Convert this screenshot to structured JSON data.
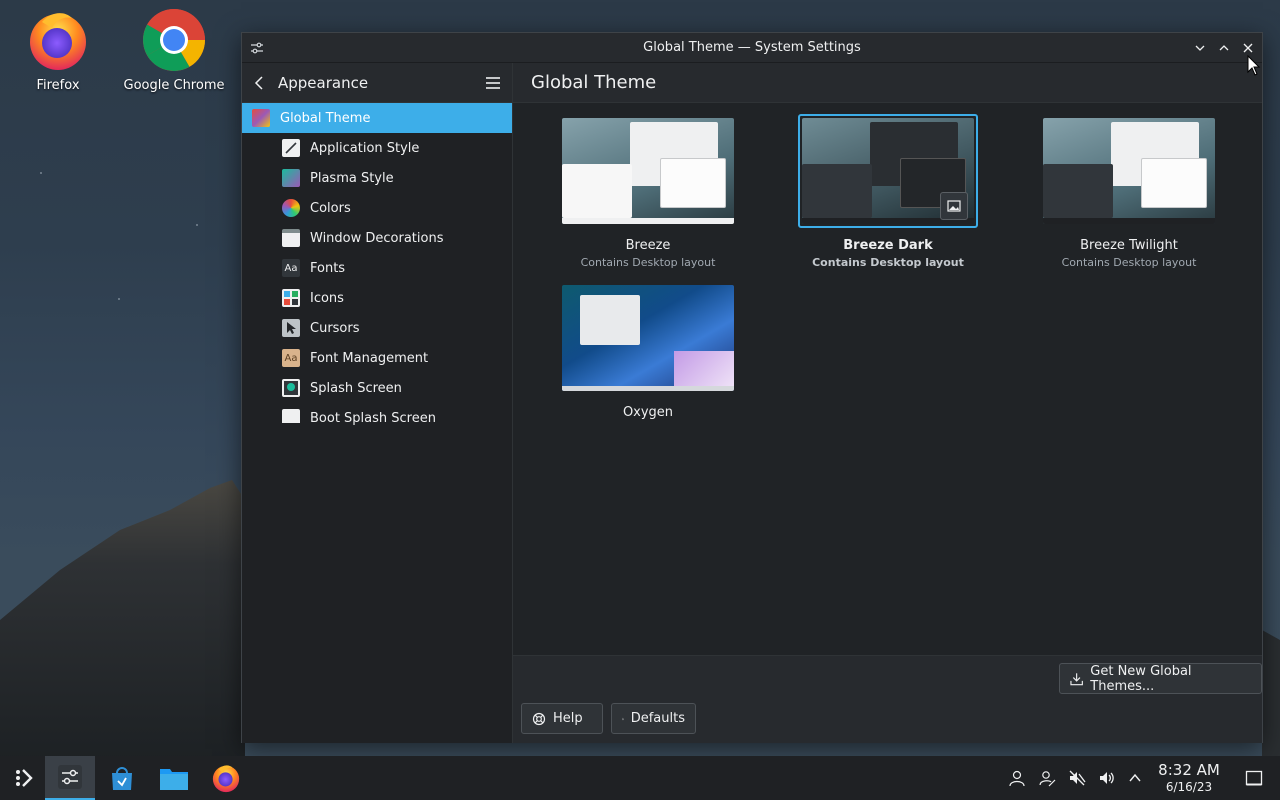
{
  "desktop": {
    "icons": [
      {
        "label": "Firefox"
      },
      {
        "label": "Google Chrome"
      }
    ]
  },
  "window": {
    "title": "Global Theme — System Settings"
  },
  "sidebar": {
    "header": "Appearance",
    "items": [
      {
        "label": "Global Theme",
        "icon": "global-theme-icon",
        "active": true
      },
      {
        "label": "Application Style",
        "icon": "application-style-icon"
      },
      {
        "label": "Plasma Style",
        "icon": "plasma-style-icon"
      },
      {
        "label": "Colors",
        "icon": "colors-icon"
      },
      {
        "label": "Window Decorations",
        "icon": "window-decorations-icon"
      },
      {
        "label": "Fonts",
        "icon": "fonts-icon"
      },
      {
        "label": "Icons",
        "icon": "icons-icon"
      },
      {
        "label": "Cursors",
        "icon": "cursors-icon"
      },
      {
        "label": "Font Management",
        "icon": "font-management-icon"
      },
      {
        "label": "Splash Screen",
        "icon": "splash-screen-icon"
      },
      {
        "label": "Boot Splash Screen",
        "icon": "boot-splash-screen-icon"
      }
    ]
  },
  "main": {
    "title": "Global Theme",
    "themes": [
      {
        "name": "Breeze",
        "subtitle": "Contains Desktop layout",
        "selected": false
      },
      {
        "name": "Breeze Dark",
        "subtitle": "Contains Desktop layout",
        "selected": true
      },
      {
        "name": "Breeze Twilight",
        "subtitle": "Contains Desktop layout",
        "selected": false
      },
      {
        "name": "Oxygen",
        "subtitle": "",
        "selected": false
      }
    ]
  },
  "footer": {
    "get_new": "Get New Global Themes...",
    "help": "Help",
    "defaults": "Defaults"
  },
  "taskbar": {
    "time": "8:32 AM",
    "date": "6/16/23"
  },
  "colors": {
    "accent": "#3daee9",
    "window_bg": "#202326",
    "header_bg": "#272a2e"
  }
}
